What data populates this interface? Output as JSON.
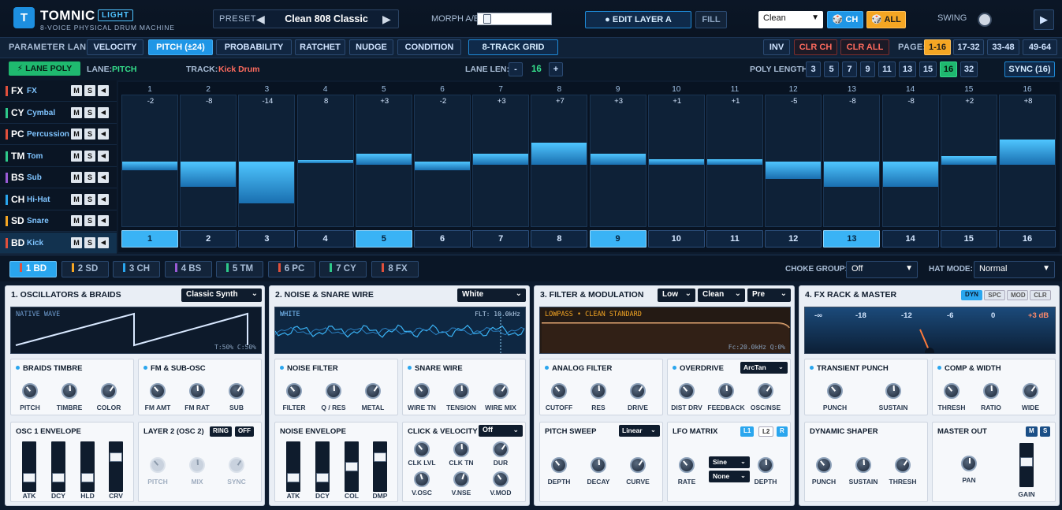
{
  "header": {
    "logo_letter": "T",
    "app_name": "TOMNIC",
    "edition": "LIGHT",
    "subtitle": "8-VOICE PHYSICAL DRUM MACHINE",
    "preset_label": "PRESET",
    "preset_name": "Clean 808 Classic",
    "preset_prev": "◀",
    "preset_next": "▶",
    "morph_label": "MORPH A/B",
    "morph_value": 0.08,
    "edit_layer": "● EDIT LAYER A",
    "fill": "FILL",
    "mode_select": "Clean",
    "ch_button": "🎲 CH",
    "all_button": "🎲 ALL",
    "swing_label": "SWING",
    "play_icon": "▶"
  },
  "param_lane": {
    "label": "PARAMETER LANE:",
    "tabs": [
      "VELOCITY",
      "PITCH (±24)",
      "PROBABILITY",
      "RATCHET",
      "NUDGE",
      "CONDITION"
    ],
    "selected": 1,
    "grid_button": "8-TRACK GRID",
    "inv": "INV",
    "clr_ch": "CLR CH",
    "clr_all": "CLR ALL",
    "page_label": "PAGE:",
    "pages": [
      "1-16",
      "17-32",
      "33-48",
      "49-64"
    ],
    "page_selected": 0
  },
  "lane_bar": {
    "lane_poly": "⚡ LANE POLY",
    "lane_prefix": "LANE:",
    "lane_value": "PITCH",
    "track_prefix": "TRACK:",
    "track_value": "Kick Drum",
    "lane_len_label": "LANE LEN:",
    "minus": "-",
    "lane_len": "16",
    "plus": "+",
    "poly_label": "POLY LENGTH:",
    "poly_options": [
      "3",
      "5",
      "7",
      "9",
      "11",
      "13",
      "15",
      "16",
      "32"
    ],
    "poly_selected": 7,
    "sync": "SYNC (16)"
  },
  "tracks": [
    {
      "abbr": "FX",
      "name": "FX",
      "color": "#e0503c"
    },
    {
      "abbr": "CY",
      "name": "Cymbal",
      "color": "#2ec98a"
    },
    {
      "abbr": "PC",
      "name": "Percussion",
      "color": "#e0503c"
    },
    {
      "abbr": "TM",
      "name": "Tom",
      "color": "#2ec98a"
    },
    {
      "abbr": "BS",
      "name": "Sub",
      "color": "#9a5bd6"
    },
    {
      "abbr": "CH",
      "name": "Hi-Hat",
      "color": "#2aa6ee"
    },
    {
      "abbr": "SD",
      "name": "Snare",
      "color": "#f5a623"
    },
    {
      "abbr": "BD",
      "name": "Kick",
      "color": "#e0503c"
    }
  ],
  "track_buttons": {
    "m": "M",
    "s": "S",
    "arrow": "◀"
  },
  "steps": [
    {
      "n": "1",
      "v": "-2",
      "val": -2,
      "on": true
    },
    {
      "n": "2",
      "v": "-8",
      "val": -8,
      "on": false
    },
    {
      "n": "3",
      "v": "-14",
      "val": -14,
      "on": false
    },
    {
      "n": "4",
      "v": "8",
      "val": 0,
      "on": false
    },
    {
      "n": "5",
      "v": "+3",
      "val": 3,
      "on": true
    },
    {
      "n": "6",
      "v": "-2",
      "val": -2,
      "on": false
    },
    {
      "n": "7",
      "v": "+3",
      "val": 3,
      "on": false
    },
    {
      "n": "8",
      "v": "+7",
      "val": 7,
      "on": false
    },
    {
      "n": "9",
      "v": "+3",
      "val": 3,
      "on": true
    },
    {
      "n": "10",
      "v": "+1",
      "val": 1,
      "on": false
    },
    {
      "n": "11",
      "v": "+1",
      "val": 1,
      "on": false
    },
    {
      "n": "12",
      "v": "-5",
      "val": -5,
      "on": false
    },
    {
      "n": "13",
      "v": "-8",
      "val": -8,
      "on": true
    },
    {
      "n": "14",
      "v": "-8",
      "val": -8,
      "on": false
    },
    {
      "n": "15",
      "v": "+2",
      "val": 2,
      "on": false
    },
    {
      "n": "16",
      "v": "+8",
      "val": 8,
      "on": false
    }
  ],
  "voices": [
    {
      "label": "1 BD",
      "color": "#e0503c"
    },
    {
      "label": "2 SD",
      "color": "#f5a623"
    },
    {
      "label": "3 CH",
      "color": "#2aa6ee"
    },
    {
      "label": "4 BS",
      "color": "#9a5bd6"
    },
    {
      "label": "5 TM",
      "color": "#2ec98a"
    },
    {
      "label": "6 PC",
      "color": "#e0503c"
    },
    {
      "label": "7 CY",
      "color": "#2ec98a"
    },
    {
      "label": "8 FX",
      "color": "#e0503c"
    }
  ],
  "voice_selected": 0,
  "choke": {
    "label": "CHOKE GROUP:",
    "value": "Off"
  },
  "hat": {
    "label": "HAT MODE:",
    "value": "Normal"
  },
  "panel1": {
    "title": "1. OSCILLATORS & BRAIDS",
    "select": "Classic Synth",
    "display_label": "NATIVE WAVE",
    "display_readout": "T:50% C:50%",
    "braids": {
      "title": "BRAIDS TIMBRE",
      "knobs": [
        "PITCH",
        "TIMBRE",
        "COLOR"
      ]
    },
    "fm": {
      "title": "FM & SUB-OSC",
      "knobs": [
        "FM AMT",
        "FM RAT",
        "SUB"
      ]
    },
    "env": {
      "title": "OSC 1 ENVELOPE",
      "faders": [
        "ATK",
        "DCY",
        "HLD",
        "CRV"
      ]
    },
    "layer2": {
      "title": "LAYER 2 (OSC 2)",
      "ring": "RING",
      "off": "OFF",
      "knobs": [
        "PITCH",
        "MIX",
        "SYNC"
      ]
    }
  },
  "panel2": {
    "title": "2. NOISE & SNARE WIRE",
    "select": "White",
    "display_label": "WHITE",
    "display_readout": "FLT: 10.0kHz",
    "noise_filter": {
      "title": "NOISE FILTER",
      "knobs": [
        "FILTER",
        "Q / RES",
        "METAL"
      ]
    },
    "snare_wire": {
      "title": "SNARE WIRE",
      "knobs": [
        "WIRE TN",
        "TENSION",
        "WIRE MIX"
      ]
    },
    "noise_env": {
      "title": "NOISE ENVELOPE",
      "faders": [
        "ATK",
        "DCY",
        "COL",
        "DMP"
      ]
    },
    "click": {
      "title": "CLICK & VELOCITY",
      "select": "Off",
      "knobs": [
        "CLK LVL",
        "CLK TN",
        "DUR",
        "V.OSC",
        "V.NSE",
        "V.MOD"
      ]
    }
  },
  "panel3": {
    "title": "3. FILTER & MODULATION",
    "sel1": "Low",
    "sel2": "Clean",
    "sel3": "Pre",
    "display_label": "LOWPASS • CLEAN STANDARD",
    "display_readout": "Fc:20.0kHz Q:0%",
    "analog": {
      "title": "ANALOG FILTER",
      "knobs": [
        "CUTOFF",
        "RES",
        "DRIVE"
      ]
    },
    "overdrive": {
      "title": "OVERDRIVE",
      "select": "ArcTan",
      "knobs": [
        "DIST DRV",
        "FEEDBACK",
        "OSC/NSE"
      ]
    },
    "pitch_sweep": {
      "title": "PITCH SWEEP",
      "select": "Linear",
      "knobs": [
        "DEPTH",
        "DECAY",
        "CURVE"
      ]
    },
    "lfo": {
      "title": "LFO MATRIX",
      "l1": "L1",
      "l2": "L2",
      "r": "R",
      "sel1": "Sine",
      "sel2": "None",
      "knobs": [
        "RATE",
        "DEPTH"
      ]
    }
  },
  "panel4": {
    "title": "4. FX RACK & MASTER",
    "tabs": [
      "DYN",
      "SPC",
      "MOD",
      "CLR"
    ],
    "meter_labels": [
      "-∞",
      "-18",
      "-12",
      "-6",
      "0",
      "+3 dB"
    ],
    "transient": {
      "title": "TRANSIENT PUNCH",
      "knobs": [
        "PUNCH",
        "SUSTAIN"
      ]
    },
    "comp": {
      "title": "COMP & WIDTH",
      "knobs": [
        "THRESH",
        "RATIO",
        "WIDE"
      ]
    },
    "dyn": {
      "title": "DYNAMIC SHAPER",
      "knobs": [
        "PUNCH",
        "SUSTAIN",
        "THRESH"
      ]
    },
    "master": {
      "title": "MASTER OUT",
      "m": "M",
      "s": "S",
      "pan": "PAN",
      "gain": "GAIN"
    }
  },
  "colors": {
    "accent": "#2aa6ee",
    "bg": "#0d1b2e",
    "green": "#1fb96f",
    "orange": "#f5a623",
    "red": "#ff6b5e"
  }
}
